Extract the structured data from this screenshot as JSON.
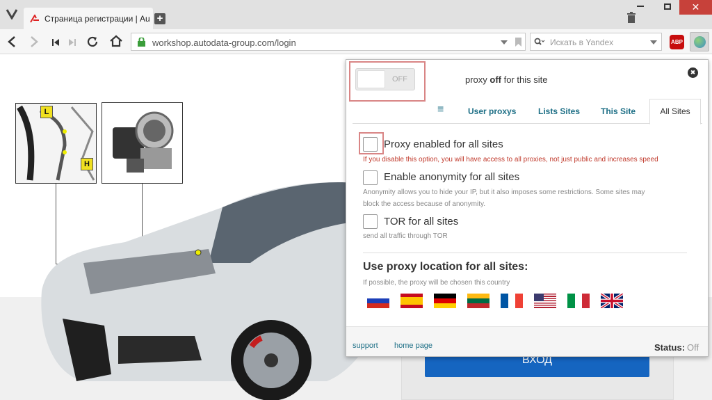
{
  "browser": {
    "tab_title": "Страница регистрации | Au",
    "new_tab": "+",
    "url": "workshop.autodata-group.com/login",
    "search_placeholder": "Искать в Yandex",
    "abp_label": "ABP"
  },
  "page": {
    "login_button": "Вход",
    "callouts": [
      "L",
      "H"
    ]
  },
  "popup": {
    "toggle_label": "OFF",
    "status_prefix": "proxy ",
    "status_bold": "off",
    "status_suffix": " for this site",
    "close_icon": "✖",
    "tabs": {
      "menu": "≡",
      "user_proxys": "User proxys",
      "lists_sites": "Lists Sites",
      "this_site": "This Site",
      "all_sites": "All Sites"
    },
    "options": [
      {
        "label": "Proxy enabled for all sites",
        "desc": "If you disable this option, you will have access to all proxies, not just public and increases speed"
      },
      {
        "label": "Enable anonymity for all sites",
        "desc1": "Anonymity allows you to hide your IP, but it also imposes some restrictions. Some sites may",
        "desc2": "block the access because of anonymity."
      },
      {
        "label": "TOR for all sites",
        "desc": "send all traffic through TOR"
      }
    ],
    "location_title": "Use proxy location for all sites:",
    "location_desc": "If possible, the proxy will be chosen this country",
    "footer": {
      "support": "support",
      "home_page": "home page",
      "status_label": "Status:",
      "status_value": "Off"
    }
  },
  "colors": {
    "accent_link": "#1d6f86",
    "warning_text": "#c0392b",
    "highlight_border": "#d98585",
    "login_button": "#1565c0"
  }
}
